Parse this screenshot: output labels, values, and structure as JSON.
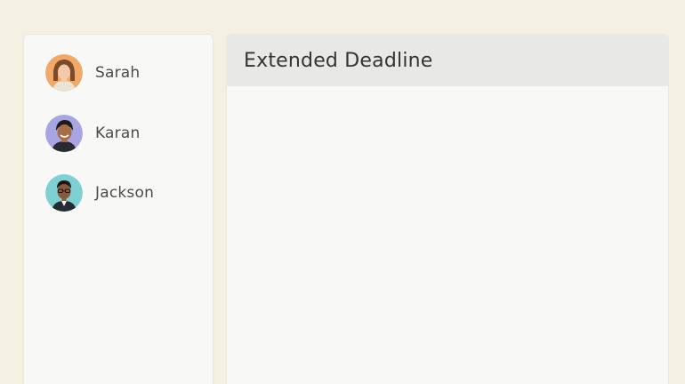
{
  "contacts": [
    {
      "name": "Sarah",
      "avatar_icon": "avatar-sarah",
      "avatar_bg": "#f2a866"
    },
    {
      "name": "Karan",
      "avatar_icon": "avatar-karan",
      "avatar_bg": "#a9a4e2"
    },
    {
      "name": "Jackson",
      "avatar_icon": "avatar-jackson",
      "avatar_bg": "#7ed0d3"
    }
  ],
  "panel": {
    "title": "Extended Deadline"
  },
  "colors": {
    "background": "#f4f0e2",
    "card": "#f8f8f6",
    "header": "#e8e8e6"
  }
}
